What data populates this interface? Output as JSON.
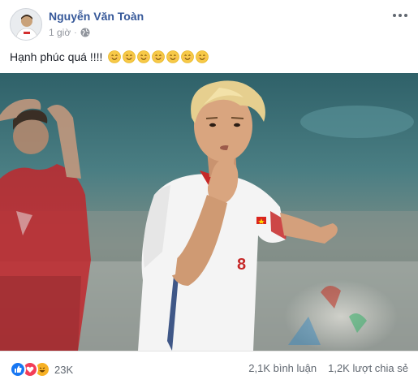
{
  "post": {
    "author": "Nguyễn Văn Toàn",
    "time": "1 giờ",
    "privacy_icon": "globe-icon",
    "menu_icon": "more-options-icon",
    "caption": "Hạnh phúc quá !!!!",
    "caption_emoji": [
      "smile-emoji",
      "smile-emoji",
      "smile-emoji",
      "smile-emoji",
      "smile-emoji",
      "smile-emoji",
      "smile-emoji"
    ],
    "photo_subject": "player-celebration-photo"
  },
  "footer": {
    "reaction_icons": [
      "like-icon",
      "love-icon",
      "haha-icon"
    ],
    "reaction_count": "23K",
    "comments": "2,1K bình luận",
    "shares": "1,2K lượt chia sẻ"
  },
  "colors": {
    "author_link": "#365899",
    "meta_text": "#90949c",
    "like": "#1877f2",
    "love": "#f33e58",
    "haha": "#f7b125"
  }
}
